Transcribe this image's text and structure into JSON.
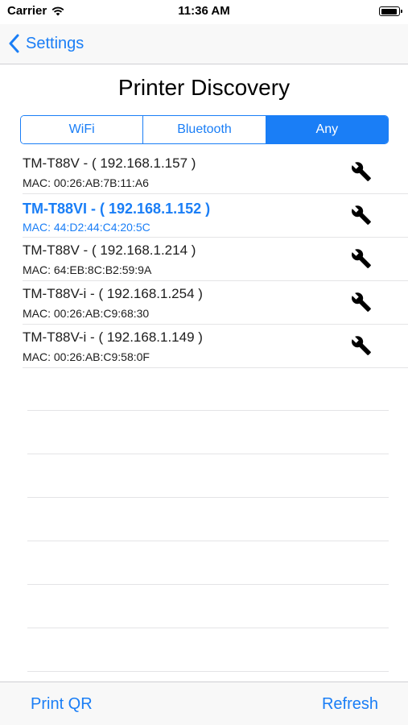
{
  "status_bar": {
    "carrier": "Carrier",
    "time": "11:36 AM"
  },
  "nav": {
    "back_label": "Settings"
  },
  "title": "Printer Discovery",
  "segments": [
    {
      "label": "WiFi",
      "selected": false
    },
    {
      "label": "Bluetooth",
      "selected": false
    },
    {
      "label": "Any",
      "selected": true
    }
  ],
  "printers": [
    {
      "name": "TM-T88V - ( 192.168.1.157 )",
      "mac": "MAC: 00:26:AB:7B:11:A6",
      "active": false
    },
    {
      "name": "TM-T88VI - ( 192.168.1.152 )",
      "mac": "MAC: 44:D2:44:C4:20:5C",
      "active": true
    },
    {
      "name": "TM-T88V - ( 192.168.1.214 )",
      "mac": "MAC: 64:EB:8C:B2:59:9A",
      "active": false
    },
    {
      "name": "TM-T88V-i - ( 192.168.1.254 )",
      "mac": "MAC: 00:26:AB:C9:68:30",
      "active": false
    },
    {
      "name": "TM-T88V-i - ( 192.168.1.149 )",
      "mac": "MAC: 00:26:AB:C9:58:0F",
      "active": false
    }
  ],
  "toolbar": {
    "print_qr": "Print QR",
    "refresh": "Refresh"
  },
  "colors": {
    "accent": "#1a7ef6"
  },
  "icons": {
    "back": "chevron-left-icon",
    "settings": "wrench-icon",
    "wifi": "wifi-icon",
    "battery": "battery-icon"
  }
}
